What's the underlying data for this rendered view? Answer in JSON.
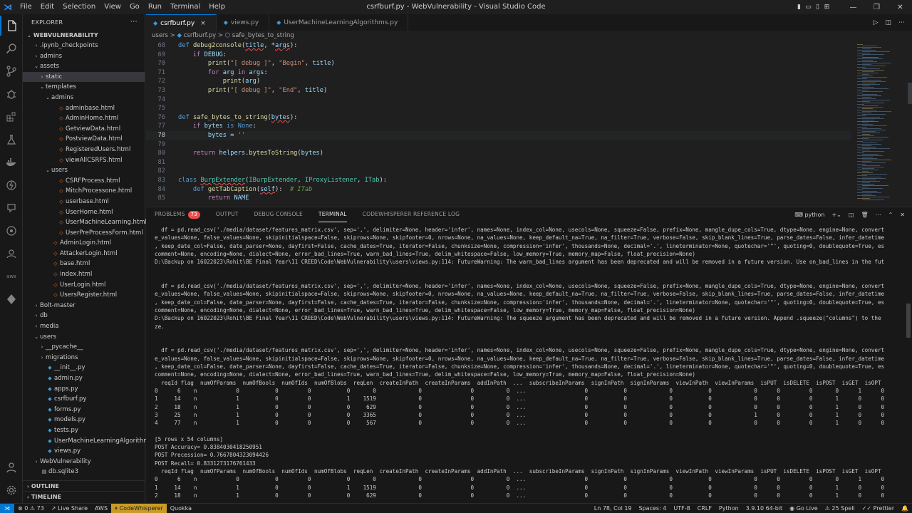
{
  "titlebar": {
    "menus": [
      "File",
      "Edit",
      "Selection",
      "View",
      "Go",
      "Run",
      "Terminal",
      "Help"
    ],
    "title": "csrfburf.py - WebVulnerability - Visual Studio Code"
  },
  "sidebar": {
    "header": "EXPLORER",
    "root": "WEBVULNERABILITY",
    "items": [
      {
        "label": ".ipynb_checkpoints",
        "depth": 1,
        "type": "folder",
        "open": false
      },
      {
        "label": "admins",
        "depth": 1,
        "type": "folder",
        "open": false
      },
      {
        "label": "assets",
        "depth": 1,
        "type": "folder",
        "open": true
      },
      {
        "label": "static",
        "depth": 2,
        "type": "folder",
        "open": false,
        "selected": true
      },
      {
        "label": "templates",
        "depth": 2,
        "type": "folder",
        "open": true
      },
      {
        "label": "admins",
        "depth": 3,
        "type": "folder",
        "open": true
      },
      {
        "label": "adminbase.html",
        "depth": 4,
        "type": "html"
      },
      {
        "label": "AdminHome.html",
        "depth": 4,
        "type": "html"
      },
      {
        "label": "GetviewData.html",
        "depth": 4,
        "type": "html"
      },
      {
        "label": "PostviewData.html",
        "depth": 4,
        "type": "html"
      },
      {
        "label": "RegisteredUsers.html",
        "depth": 4,
        "type": "html"
      },
      {
        "label": "viewAllCSRFS.html",
        "depth": 4,
        "type": "html"
      },
      {
        "label": "users",
        "depth": 3,
        "type": "folder",
        "open": true
      },
      {
        "label": "CSRFProcess.html",
        "depth": 4,
        "type": "html"
      },
      {
        "label": "MitchProcessone.html",
        "depth": 4,
        "type": "html"
      },
      {
        "label": "userbase.html",
        "depth": 4,
        "type": "html"
      },
      {
        "label": "UserHome.html",
        "depth": 4,
        "type": "html"
      },
      {
        "label": "UserMachineLearning.html",
        "depth": 4,
        "type": "html"
      },
      {
        "label": "UserPreProcessForm.html",
        "depth": 4,
        "type": "html"
      },
      {
        "label": "AdminLogin.html",
        "depth": 3,
        "type": "html"
      },
      {
        "label": "AttackerLogin.html",
        "depth": 3,
        "type": "html"
      },
      {
        "label": "base.html",
        "depth": 3,
        "type": "html"
      },
      {
        "label": "index.html",
        "depth": 3,
        "type": "html"
      },
      {
        "label": "UserLogin.html",
        "depth": 3,
        "type": "html"
      },
      {
        "label": "UsersRegister.html",
        "depth": 3,
        "type": "html"
      },
      {
        "label": "Bolt-master",
        "depth": 1,
        "type": "folder",
        "open": false
      },
      {
        "label": "db",
        "depth": 1,
        "type": "folder",
        "open": false
      },
      {
        "label": "media",
        "depth": 1,
        "type": "folder",
        "open": false
      },
      {
        "label": "users",
        "depth": 1,
        "type": "folder",
        "open": true
      },
      {
        "label": "__pycache__",
        "depth": 2,
        "type": "folder",
        "open": false
      },
      {
        "label": "migrations",
        "depth": 2,
        "type": "folder",
        "open": false
      },
      {
        "label": "__init__.py",
        "depth": 2,
        "type": "py"
      },
      {
        "label": "admin.py",
        "depth": 2,
        "type": "py"
      },
      {
        "label": "apps.py",
        "depth": 2,
        "type": "py"
      },
      {
        "label": "csrfburf.py",
        "depth": 2,
        "type": "py"
      },
      {
        "label": "forms.py",
        "depth": 2,
        "type": "py"
      },
      {
        "label": "models.py",
        "depth": 2,
        "type": "py"
      },
      {
        "label": "tests.py",
        "depth": 2,
        "type": "py"
      },
      {
        "label": "UserMachineLearningAlgorithm...",
        "depth": 2,
        "type": "py"
      },
      {
        "label": "views.py",
        "depth": 2,
        "type": "py"
      },
      {
        "label": "WebVulnerability",
        "depth": 1,
        "type": "folder",
        "open": false
      },
      {
        "label": "db.sqlite3",
        "depth": 1,
        "type": "db"
      }
    ],
    "outline": "OUTLINE",
    "timeline": "TIMELINE"
  },
  "editor": {
    "tabs": [
      {
        "label": "csrfburf.py",
        "active": true,
        "close": "×"
      },
      {
        "label": "views.py",
        "active": false
      },
      {
        "label": "UserMachineLearningAlgorithms.py",
        "active": false
      }
    ],
    "breadcrumb": [
      "users",
      ">",
      "csrfburf.py",
      ">",
      "safe_bytes_to_string"
    ],
    "lines": [
      {
        "n": "68",
        "cur": false
      },
      {
        "n": "69",
        "cur": false
      },
      {
        "n": "70",
        "cur": false
      },
      {
        "n": "71",
        "cur": false
      },
      {
        "n": "72",
        "cur": false
      },
      {
        "n": "73",
        "cur": false
      },
      {
        "n": "74",
        "cur": false
      },
      {
        "n": "75",
        "cur": false
      },
      {
        "n": "76",
        "cur": false
      },
      {
        "n": "77",
        "cur": false
      },
      {
        "n": "78",
        "cur": true
      },
      {
        "n": "79",
        "cur": false
      },
      {
        "n": "80",
        "cur": false
      },
      {
        "n": "81",
        "cur": false
      },
      {
        "n": "82",
        "cur": false
      },
      {
        "n": "83",
        "cur": false
      },
      {
        "n": "84",
        "cur": false
      },
      {
        "n": "85",
        "cur": false
      }
    ]
  },
  "panel": {
    "tabs": [
      "PROBLEMS",
      "OUTPUT",
      "DEBUG CONSOLE",
      "TERMINAL",
      "CODEWHISPERER REFERENCE LOG"
    ],
    "problems_count": "73",
    "active_tab": "TERMINAL",
    "shell": "python",
    "terminal_lines": [
      "  df = pd.read_csv('./media/dataset/features_matrix.csv', sep=',', delimiter=None, header='infer', names=None, index_col=None, usecols=None, squeeze=False, prefix=None, mangle_dupe_cols=True, dtype=None, engine=None, convert",
      "e_values=None, false_values=None, skipinitialspace=False, skiprows=None, skipfooter=0, nrows=None, na_values=None, keep_default_na=True, na_filter=True, verbose=False, skip_blank_lines=True, parse_dates=False, infer_datetime",
      ", keep_date_col=False, date_parser=None, dayfirst=False, cache_dates=True, iterator=False, chunksize=None, compression='infer', thousands=None, decimal='.', lineterminator=None, quotechar='\"', quoting=0, doublequote=True, es",
      "comment=None, encoding=None, dialect=None, error_bad_lines=True, warn_bad_lines=True, delim_whitespace=False, low_memory=True, memory_map=False, float_precision=None)",
      "D:\\Backup on 16022023\\Rohit\\BE Final Year\\11 CREED\\Code\\WebVulnerability\\users\\views.py:114: FutureWarning: The warn_bad_lines argument has been deprecated and will be removed in a future version. Use on_bad_lines in the fut",
      "",
      "",
      "  df = pd.read_csv('./media/dataset/features_matrix.csv', sep=',', delimiter=None, header='infer', names=None, index_col=None, usecols=None, squeeze=False, prefix=None, mangle_dupe_cols=True, dtype=None, engine=None, convert",
      "e_values=None, false_values=None, skipinitialspace=False, skiprows=None, skipfooter=0, nrows=None, na_values=None, keep_default_na=True, na_filter=True, verbose=False, skip_blank_lines=True, parse_dates=False, infer_datetime",
      ", keep_date_col=False, date_parser=None, dayfirst=False, cache_dates=True, iterator=False, chunksize=None, compression='infer', thousands=None, decimal='.', lineterminator=None, quotechar='\"', quoting=0, doublequote=True, es",
      "comment=None, encoding=None, dialect=None, error_bad_lines=True, warn_bad_lines=True, delim_whitespace=False, low_memory=True, memory_map=False, float_precision=None)",
      "D:\\Backup on 16022023\\Rohit\\BE Final Year\\11 CREED\\Code\\WebVulnerability\\users\\views.py:114: FutureWarning: The squeeze argument has been deprecated and will be removed in a future version. Append .squeeze(\"columns\") to the",
      "ze.",
      "",
      "",
      "  df = pd.read_csv('./media/dataset/features_matrix.csv', sep=',', delimiter=None, header='infer', names=None, index_col=None, usecols=None, squeeze=False, prefix=None, mangle_dupe_cols=True, dtype=None, engine=None, convert",
      "e_values=None, false_values=None, skipinitialspace=False, skiprows=None, skipfooter=0, nrows=None, na_values=None, keep_default_na=True, na_filter=True, verbose=False, skip_blank_lines=True, parse_dates=False, infer_datetime",
      ", keep_date_col=False, date_parser=None, dayfirst=False, cache_dates=True, iterator=False, chunksize=None, compression='infer', thousands=None, decimal='.', lineterminator=None, quotechar='\"', quoting=0, doublequote=True, es",
      "comment=None, encoding=None, dialect=None, error_bad_lines=True, warn_bad_lines=True, delim_whitespace=False, low_memory=True, memory_map=False, float_precision=None)",
      "  reqId flag  numOfParams  numOfBools  numOfIds  numOfBlobs  reqLen  createInPath  createInParams  addInPath  ...  subscribeInParams  signInPath  signInParams  viewInPath  viewInParams  isPUT  isDELETE  isPOST  isGET  isOPT",
      "0      6    n            0           0         0           0       0             0               0          0  ...                  0           0             0           0             0      0         0       0      1      0",
      "1     14    n            1           0         0           1    1519             0               0          0  ...                  0           0             0           0             0      0         0       1      0      0",
      "2     18    n            1           0         0           0     629             0               0          0  ...                  0           0             0           0             0      0         0       1      0      0",
      "3     25    n            1           0         0           0    3365             0               0          0  ...                  0           0             0           0             1      0         0       1      0      0",
      "4     77    n            1           0         0           0     567             0               0          0  ...                  0           0             0           0             0      0         0       1      0      0",
      "",
      "[5 rows x 54 columns]",
      "POST Accuracy= 0.8384030418250951",
      "POST Precession= 0.7667804323094426",
      "POST Recall= 0.8331273176761433",
      "  reqId flag  numOfParams  numOfBools  numOfIds  numOfBlobs  reqLen  createInPath  createInParams  addInPath  ...  subscribeInParams  signInPath  signInParams  viewInPath  viewInParams  isPUT  isDELETE  isPOST  isGET  isOPT",
      "0      6    n            0           0         0           0       0             0               0          0  ...                  0           0             0           0             0      0         0       0      1      0",
      "1     14    n            1           0         0           1    1519             0               0          0  ...                  0           0             0           0             0      0         0       1      0      0",
      "2     18    n            1           0         0           0     629             0               0          0  ...                  0           0             0           0             0      0         0       1      0      0"
    ]
  },
  "statusbar": {
    "errors": "0",
    "warnings": "73",
    "live_share": "Live Share",
    "aws": "AWS",
    "codewhisperer": "CodeWhisperer",
    "quokka": "Quokka",
    "position": "Ln 78, Col 19",
    "spaces": "Spaces: 4",
    "encoding": "UTF-8",
    "eol": "CRLF",
    "language": "Python",
    "interpreter": "3.9.10 64-bit",
    "golive": "Go Live",
    "spell": "25 Spell",
    "prettier": "Prettier"
  }
}
